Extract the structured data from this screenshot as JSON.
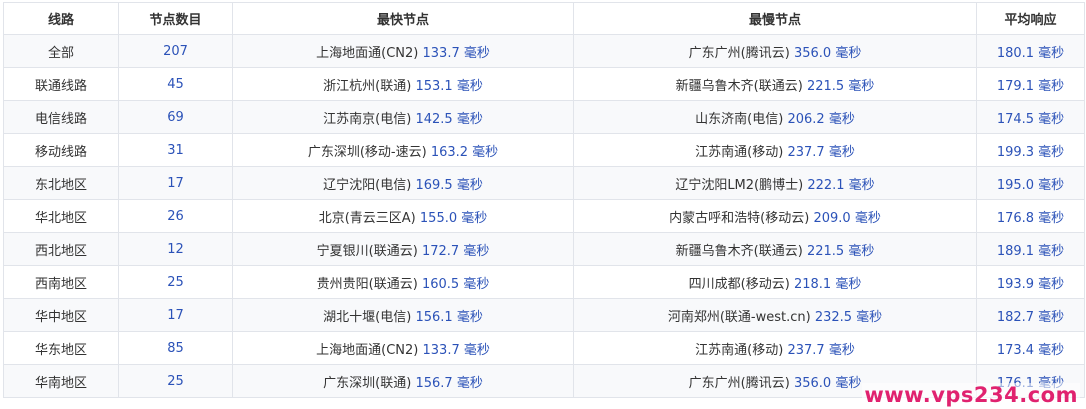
{
  "table": {
    "headers": [
      "线路",
      "节点数目",
      "最快节点",
      "最慢节点",
      "平均响应"
    ],
    "rows": [
      {
        "line": "全部",
        "count": "207",
        "fastest_name": "上海地面通(CN2)",
        "fastest_ms": "133.7 毫秒",
        "slowest_name": "广东广州(腾讯云)",
        "slowest_ms": "356.0 毫秒",
        "average": "180.1 毫秒"
      },
      {
        "line": "联通线路",
        "count": "45",
        "fastest_name": "浙江杭州(联通)",
        "fastest_ms": "153.1 毫秒",
        "slowest_name": "新疆乌鲁木齐(联通云)",
        "slowest_ms": "221.5 毫秒",
        "average": "179.1 毫秒"
      },
      {
        "line": "电信线路",
        "count": "69",
        "fastest_name": "江苏南京(电信)",
        "fastest_ms": "142.5 毫秒",
        "slowest_name": "山东济南(电信)",
        "slowest_ms": "206.2 毫秒",
        "average": "174.5 毫秒"
      },
      {
        "line": "移动线路",
        "count": "31",
        "fastest_name": "广东深圳(移动-速云)",
        "fastest_ms": "163.2 毫秒",
        "slowest_name": "江苏南通(移动)",
        "slowest_ms": "237.7 毫秒",
        "average": "199.3 毫秒"
      },
      {
        "line": "东北地区",
        "count": "17",
        "fastest_name": "辽宁沈阳(电信)",
        "fastest_ms": "169.5 毫秒",
        "slowest_name": "辽宁沈阳LM2(鹏博士)",
        "slowest_ms": "222.1 毫秒",
        "average": "195.0 毫秒"
      },
      {
        "line": "华北地区",
        "count": "26",
        "fastest_name": "北京(青云三区A)",
        "fastest_ms": "155.0 毫秒",
        "slowest_name": "内蒙古呼和浩特(移动云)",
        "slowest_ms": "209.0 毫秒",
        "average": "176.8 毫秒"
      },
      {
        "line": "西北地区",
        "count": "12",
        "fastest_name": "宁夏银川(联通云)",
        "fastest_ms": "172.7 毫秒",
        "slowest_name": "新疆乌鲁木齐(联通云)",
        "slowest_ms": "221.5 毫秒",
        "average": "189.1 毫秒"
      },
      {
        "line": "西南地区",
        "count": "25",
        "fastest_name": "贵州贵阳(联通云)",
        "fastest_ms": "160.5 毫秒",
        "slowest_name": "四川成都(移动云)",
        "slowest_ms": "218.1 毫秒",
        "average": "193.9 毫秒"
      },
      {
        "line": "华中地区",
        "count": "17",
        "fastest_name": "湖北十堰(电信)",
        "fastest_ms": "156.1 毫秒",
        "slowest_name": "河南郑州(联通-west.cn)",
        "slowest_ms": "232.5 毫秒",
        "average": "182.7 毫秒"
      },
      {
        "line": "华东地区",
        "count": "85",
        "fastest_name": "上海地面通(CN2)",
        "fastest_ms": "133.7 毫秒",
        "slowest_name": "江苏南通(移动)",
        "slowest_ms": "237.7 毫秒",
        "average": "173.4 毫秒"
      },
      {
        "line": "华南地区",
        "count": "25",
        "fastest_name": "广东深圳(联通)",
        "fastest_ms": "156.7 毫秒",
        "slowest_name": "广东广州(腾讯云)",
        "slowest_ms": "356.0 毫秒",
        "average": "176.1 毫秒"
      }
    ]
  },
  "watermark": "www.vps234.com",
  "colors": {
    "number": "#2b52b8",
    "text": "#333333",
    "border": "#e1e4ea",
    "stripe": "#f8f9fb",
    "watermark": "#e0226f"
  }
}
